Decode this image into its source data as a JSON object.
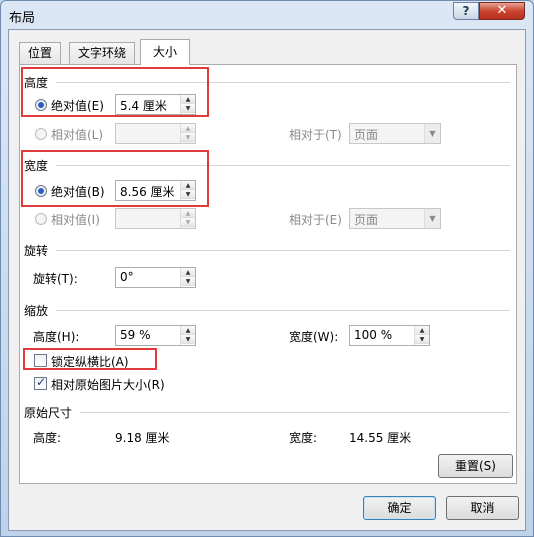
{
  "window": {
    "title": "布局",
    "help_label": "?",
    "close_label": "✕"
  },
  "tabs": [
    {
      "label": "位置"
    },
    {
      "label": "文字环绕"
    },
    {
      "label": "大小"
    }
  ],
  "height_section": {
    "title": "高度",
    "absolute_label": "绝对值(E)",
    "absolute_value": "5.4 厘米",
    "relative_label": "相对值(L)",
    "relative_to_label": "相对于(T)",
    "relative_to_value": "页面"
  },
  "width_section": {
    "title": "宽度",
    "absolute_label": "绝对值(B)",
    "absolute_value": "8.56 厘米",
    "relative_label": "相对值(I)",
    "relative_to_label": "相对于(E)",
    "relative_to_value": "页面"
  },
  "rotate_section": {
    "title": "旋转",
    "rotate_label": "旋转(T):",
    "rotate_value": "0°"
  },
  "scale_section": {
    "title": "缩放",
    "height_label": "高度(H):",
    "height_value": "59 %",
    "width_label": "宽度(W):",
    "width_value": "100 %",
    "lock_label": "锁定纵横比(A)",
    "lock_checked": false,
    "relative_label": "相对原始图片大小(R)",
    "relative_checked": true
  },
  "original_section": {
    "title": "原始尺寸",
    "height_label": "高度:",
    "height_value": "9.18 厘米",
    "width_label": "宽度:",
    "width_value": "14.55 厘米"
  },
  "buttons": {
    "reset": "重置(S)",
    "ok": "确定",
    "cancel": "取消"
  }
}
